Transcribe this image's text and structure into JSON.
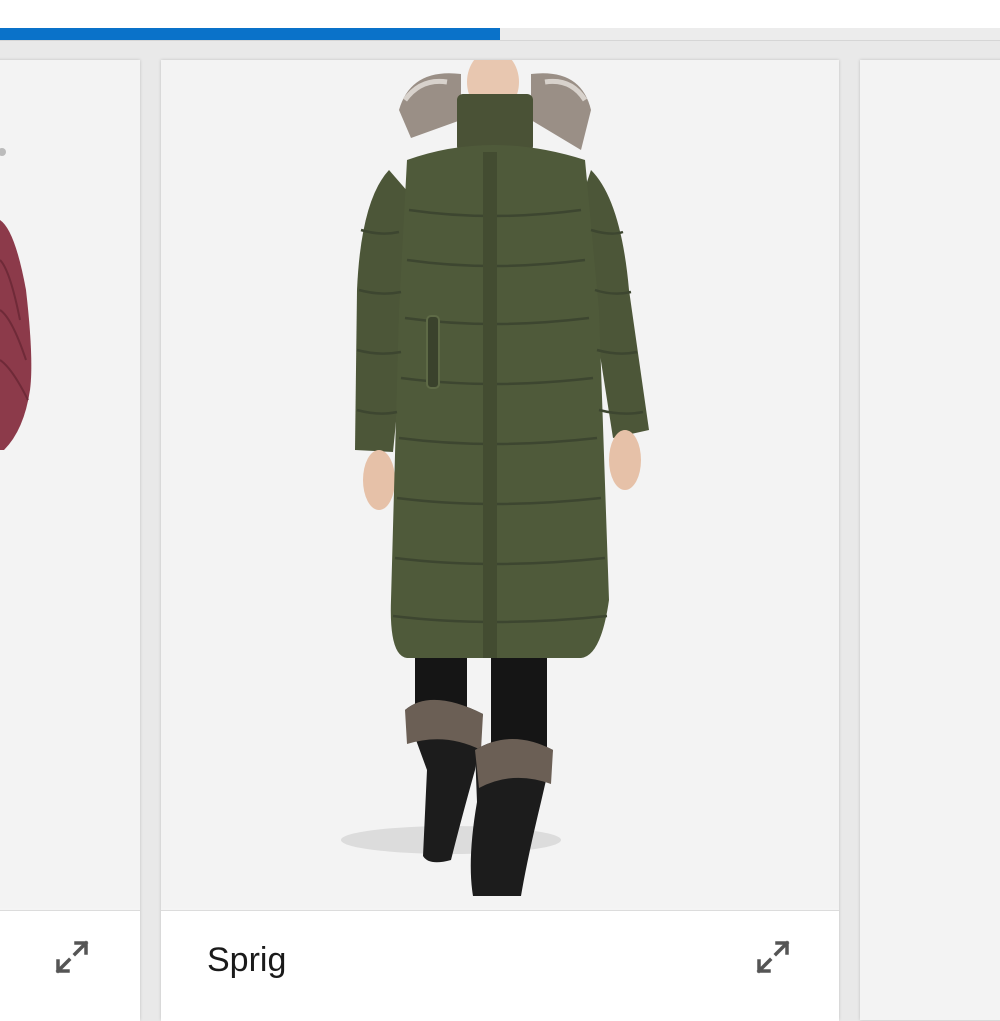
{
  "progress": {
    "fraction": 0.5,
    "color": "#0a72c9"
  },
  "cards": [
    {
      "color_name": "",
      "swatch": "#8c3a4a",
      "expand_icon": "expand-arrows-icon"
    },
    {
      "color_name": "Sprig",
      "swatch": "#4c5638",
      "expand_icon": "expand-arrows-icon"
    },
    {
      "color_name": ""
    }
  ]
}
